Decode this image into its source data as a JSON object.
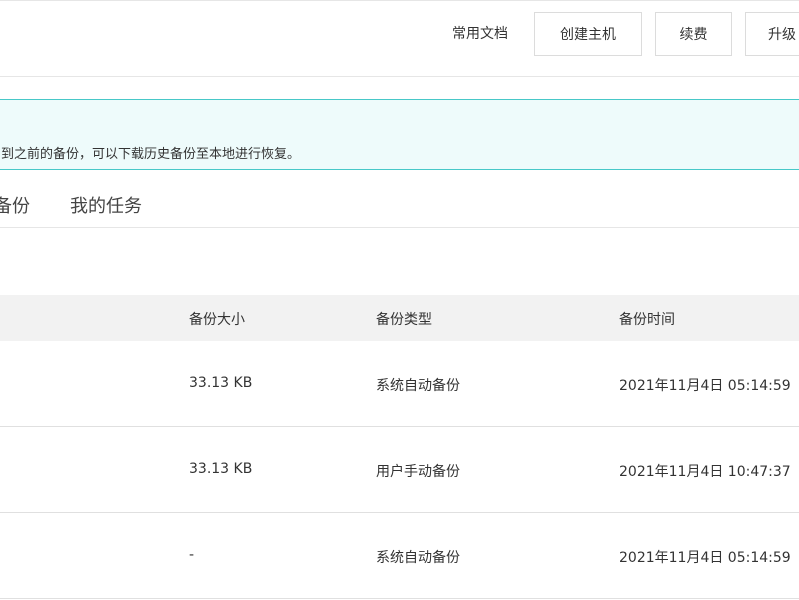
{
  "toolbar": {
    "doc_link": "常用文档",
    "create_host": "创建主机",
    "renew": "续费",
    "upgrade": "升级"
  },
  "notice": {
    "text": "到之前的备份，可以下载历史备份至本地进行恢复。"
  },
  "tabs": [
    {
      "label": "备份"
    },
    {
      "label": "我的任务"
    }
  ],
  "table": {
    "headers": {
      "size": "备份大小",
      "type": "备份类型",
      "time": "备份时间"
    },
    "rows": [
      {
        "size": "33.13 KB",
        "type": "系统自动备份",
        "time": "2021年11月4日 05:14:59"
      },
      {
        "size": "33.13 KB",
        "type": "用户手动备份",
        "time": "2021年11月4日 10:47:37"
      },
      {
        "size": "-",
        "type": "系统自动备份",
        "time": "2021年11月4日 05:14:59"
      }
    ]
  }
}
